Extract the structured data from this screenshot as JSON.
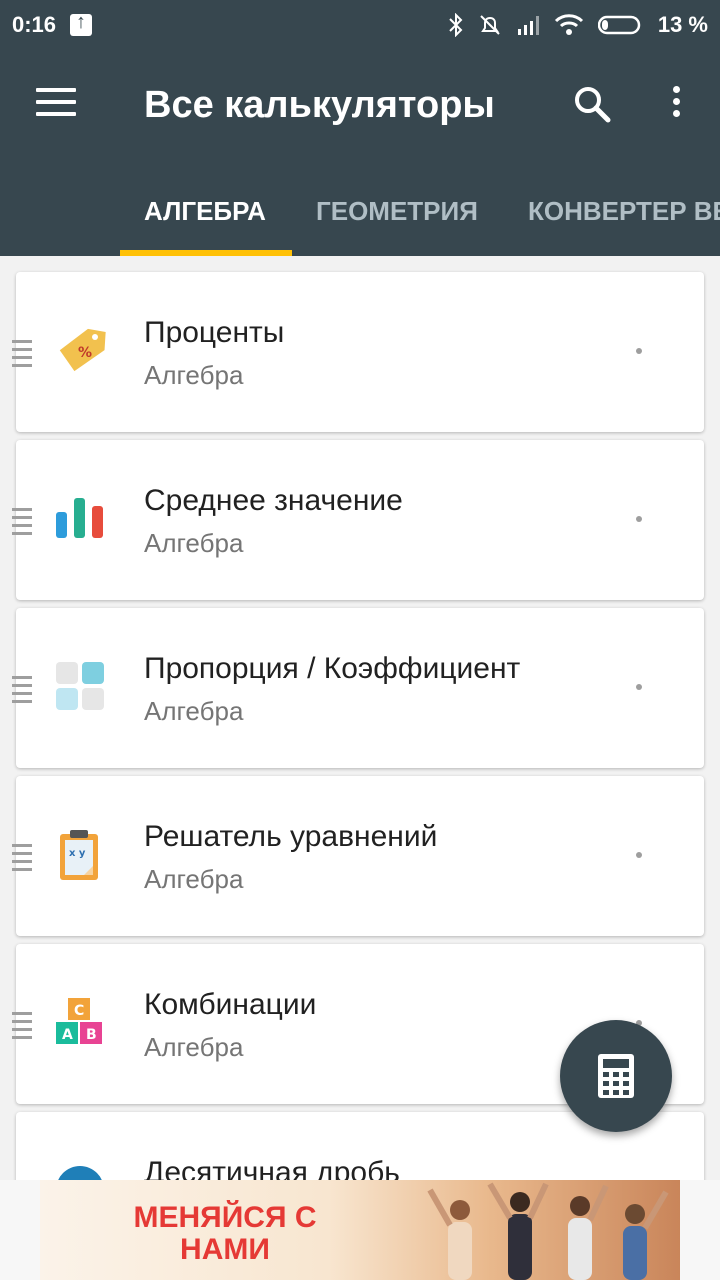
{
  "status_bar": {
    "time": "0:16",
    "battery_percent": "13 %"
  },
  "app_bar": {
    "title": "Все калькуляторы"
  },
  "tabs": [
    {
      "label": "АЛГЕБРА",
      "active": true
    },
    {
      "label": "ГЕОМЕТРИЯ",
      "active": false
    },
    {
      "label": "КОНВЕРТЕР ВЕ",
      "active": false
    }
  ],
  "calculators": [
    {
      "title": "Проценты",
      "category": "Алгебра",
      "icon": "percent-tag-icon"
    },
    {
      "title": "Среднее значение",
      "category": "Алгебра",
      "icon": "bar-chart-icon"
    },
    {
      "title": "Пропорция / Коэффициент",
      "category": "Алгебра",
      "icon": "proportion-grid-icon"
    },
    {
      "title": "Решатель уравнений",
      "category": "Алгебра",
      "icon": "clipboard-xy-icon"
    },
    {
      "title": "Комбинации",
      "category": "Алгебра",
      "icon": "abc-blocks-icon"
    },
    {
      "title": "Десятичная дробь",
      "category": "",
      "icon": "pie-icon"
    }
  ],
  "ad": {
    "text_line1": "МЕНЯЙСЯ С",
    "text_line2": "НАМИ"
  },
  "colors": {
    "primary": "#37474f",
    "accent": "#ffc107"
  }
}
